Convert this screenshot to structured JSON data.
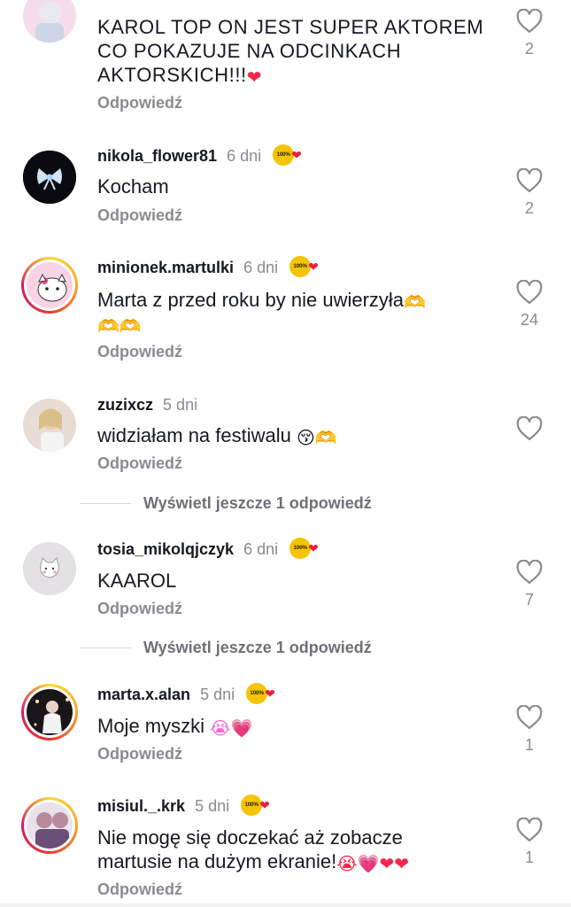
{
  "comments": [
    {
      "username": "",
      "time": "",
      "text": "KAROL TOP ON JEST SUPER AKTOREM CO POKAZUJE NA ODCINKACH AKTORSKICH!!!",
      "text_emoji": "❤",
      "reply_label": "Odpowiedź",
      "likes": "2"
    },
    {
      "username": "nikola_flower81",
      "time": "6 dni",
      "badge": "100%",
      "text": "Kocham",
      "reply_label": "Odpowiedź",
      "likes": "2"
    },
    {
      "username": "minionek.martulki",
      "time": "6 dni",
      "badge": "100%",
      "text": "Marta z przed roku by nie uwierzyła",
      "text_emoji": "🫶",
      "text_emoji_line2": "🫶🫶",
      "reply_label": "Odpowiedź",
      "likes": "24"
    },
    {
      "username": "zuzixcz",
      "time": "5 dni",
      "text": "widziałam na festiwalu",
      "text_emoji": "😚🫶",
      "reply_label": "Odpowiedź",
      "likes": ""
    },
    {
      "username": "tosia_mikolqjczyk",
      "time": "6 dni",
      "badge": "100%",
      "text": "KAAROL",
      "reply_label": "Odpowiedź",
      "likes": "7"
    },
    {
      "username": "marta.x.alan",
      "time": "5 dni",
      "badge": "100%",
      "text": "Moje myszki",
      "text_emoji": "😭💗",
      "reply_label": "Odpowiedź",
      "likes": "1"
    },
    {
      "username": "misiul._.krk",
      "time": "5 dni",
      "badge": "100%",
      "text": "Nie mogę się doczekać aż zobacze martusie na dużym ekranie!",
      "text_emoji": "😭💗❤❤",
      "reply_label": "Odpowiedź",
      "likes": "1"
    }
  ],
  "view_more_1": "Wyświetl jeszcze 1 odpowiedź",
  "view_more_2": "Wyświetl jeszcze 1 odpowiedź",
  "icons": {
    "like": "heart-outline-icon",
    "badge": "top-fan-badge-icon"
  },
  "colors": {
    "badge": "#f5c400",
    "heart": "#e81f3f",
    "muted": "#8a8b91"
  }
}
